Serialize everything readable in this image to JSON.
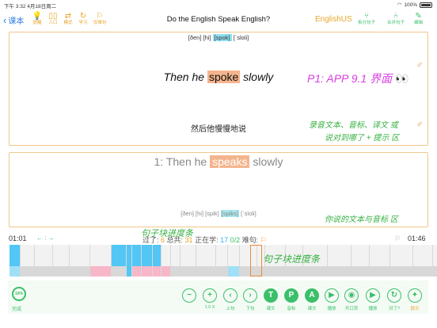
{
  "status": {
    "time": "下午 3:32",
    "date": "4月18日周二",
    "battery": "100%"
  },
  "nav": {
    "back_label": "课本",
    "tools": [
      {
        "icon": "bulb-icon",
        "glyph": "💡",
        "label": "提醒"
      },
      {
        "icon": "book-icon",
        "glyph": "▯▯",
        "label": "入口"
      },
      {
        "icon": "shuffle-icon",
        "glyph": "⇄",
        "label": "模式"
      },
      {
        "icon": "refresh-icon",
        "glyph": "↻",
        "label": "学习"
      },
      {
        "icon": "flag-icon",
        "glyph": "⚐",
        "label": "仅难句"
      }
    ],
    "title": "Do the English Speak English?",
    "lang": "EnglishUS",
    "right_tools": [
      {
        "icon": "split-icon",
        "glyph": "⑂",
        "label": "拆分句子"
      },
      {
        "icon": "merge-icon",
        "glyph": "⑃",
        "label": "合并句子"
      },
      {
        "icon": "edit-icon",
        "glyph": "✎",
        "label": "编辑"
      }
    ]
  },
  "panel1": {
    "phonetic_pre": "[ðen] [hi] ",
    "phonetic_hl": "[spok]",
    "phonetic_post": " [ˈsloli]",
    "sentence_pre": "Then he ",
    "sentence_hl": "spoke",
    "sentence_post": " slowly",
    "annotation_title": "P1:  APP 9.1 界面",
    "annotation_eyes": "👀",
    "translation": "然后他慢慢地说",
    "annotation_line1": "录音文本、音标、译文 或",
    "annotation_line2": "说对到哪了 + 提示 区"
  },
  "panel2": {
    "sentence_pre": "1:  Then he ",
    "sentence_hl": "speaks",
    "sentence_post": " slowly",
    "phonetic_pre": "[ðen] [hi] [spik] ",
    "phonetic_hl": "[spiks]",
    "phonetic_post": " [ˈsloli]",
    "annotation": "你说的文本与音标 区"
  },
  "progress": {
    "start_time": "01:01",
    "nav_arrows": "← : →",
    "annotation_top": "句子块进度条",
    "passed_label": "过了: ",
    "passed_value": "6",
    "total_label": "  总共: ",
    "total_value": "31",
    "learning_label": "  正在学: ",
    "learning_value": "17",
    "learning_sep": " ",
    "learning_frac": "0/2",
    "hard_label": "    难句: ",
    "end_time": "01:46",
    "annotation_bottom": "句子块进度条"
  },
  "timeline_blocks": [
    {
      "w": 14,
      "top": "#52c6f5",
      "bot": "#9fe0f7"
    },
    {
      "w": 18,
      "top": "#f2f2f2",
      "bot": "#d8d8d8"
    },
    {
      "w": 23,
      "top": "#f2f2f2",
      "bot": "#d8d8d8"
    },
    {
      "w": 21,
      "top": "#f2f2f2",
      "bot": "#d8d8d8"
    },
    {
      "w": 26,
      "top": "#f2f2f2",
      "bot": "#d8d8d8"
    },
    {
      "w": 27,
      "top": "#f2f2f2",
      "bot": "#f7b7c8"
    },
    {
      "w": 19,
      "top": "#52c6f5",
      "bot": "#d8d8d8"
    },
    {
      "w": 7,
      "top": "#52c6f5",
      "bot": "#52c6f5"
    },
    {
      "w": 12,
      "top": "#52c6f5",
      "bot": "#f7b7c8"
    },
    {
      "w": 14,
      "top": "#52c6f5",
      "bot": "#f7b7c8"
    },
    {
      "w": 11,
      "top": "#52c6f5",
      "bot": "#f7b7c8"
    },
    {
      "w": 12,
      "top": "#f2f2f2",
      "bot": "#f7b7c8"
    },
    {
      "w": 12,
      "top": "#f2f2f2",
      "bot": "#d8d8d8"
    },
    {
      "w": 20,
      "top": "#f2f2f2",
      "bot": "#d8d8d8"
    },
    {
      "w": 25,
      "top": "#f2f2f2",
      "bot": "#d8d8d8"
    },
    {
      "w": 15,
      "top": "#f2f2f2",
      "bot": "#d8d8d8"
    },
    {
      "w": 15,
      "top": "#f2f2f2",
      "bot": "#9fe0f7"
    },
    {
      "w": 22,
      "top": "#f2f2f2",
      "bot": "#d8d8d8"
    },
    {
      "w": 10,
      "top": "#f2f2f2",
      "bot": "#d8d8d8"
    },
    {
      "w": 26,
      "top": "#f2f2f2",
      "bot": "#d8d8d8"
    },
    {
      "w": 22,
      "top": "#f2f2f2",
      "bot": "#d8d8d8"
    },
    {
      "w": 31,
      "top": "#f2f2f2",
      "bot": "#d8d8d8"
    },
    {
      "w": 30,
      "top": "#f2f2f2",
      "bot": "#d8d8d8"
    },
    {
      "w": 23,
      "top": "#f2f2f2",
      "bot": "#d8d8d8"
    },
    {
      "w": 26,
      "top": "#f2f2f2",
      "bot": "#d8d8d8"
    },
    {
      "w": 29,
      "top": "#f2f2f2",
      "bot": "#d8d8d8"
    },
    {
      "w": 25,
      "top": "#f2f2f2",
      "bot": "#d8d8d8"
    },
    {
      "w": 15,
      "top": "#f2f2f2",
      "bot": "#d8d8d8"
    }
  ],
  "bottom": {
    "progress_pct": "10%",
    "done_label": "完成",
    "buttons": [
      {
        "name": "zoom-out-button",
        "glyph": "−",
        "label": "",
        "style": "out"
      },
      {
        "name": "zoom-in-button",
        "glyph": "+",
        "label": "1.0 X",
        "style": "out"
      },
      {
        "name": "prev-sentence-button",
        "glyph": "‹",
        "label": "上句",
        "style": "out"
      },
      {
        "name": "next-sentence-button",
        "glyph": "›",
        "label": "下句",
        "style": "out"
      },
      {
        "name": "text-toggle-button",
        "glyph": "T",
        "label": "课文",
        "style": "fill"
      },
      {
        "name": "phonetic-toggle-button",
        "glyph": "P",
        "label": "音标",
        "style": "fill"
      },
      {
        "name": "translation-toggle-button",
        "glyph": "A",
        "label": "课文",
        "style": "fill"
      },
      {
        "name": "play-button",
        "glyph": "▶",
        "label": "播放",
        "style": "out"
      },
      {
        "name": "record-button",
        "glyph": "◉",
        "label": "开口背",
        "style": "out"
      },
      {
        "name": "playback-button",
        "glyph": "▶",
        "label": "播放",
        "style": "out"
      },
      {
        "name": "check-button",
        "glyph": "↻",
        "label": "对了?",
        "style": "out"
      },
      {
        "name": "hint-button",
        "glyph": "✦",
        "label": "提示",
        "style": "out"
      }
    ]
  }
}
